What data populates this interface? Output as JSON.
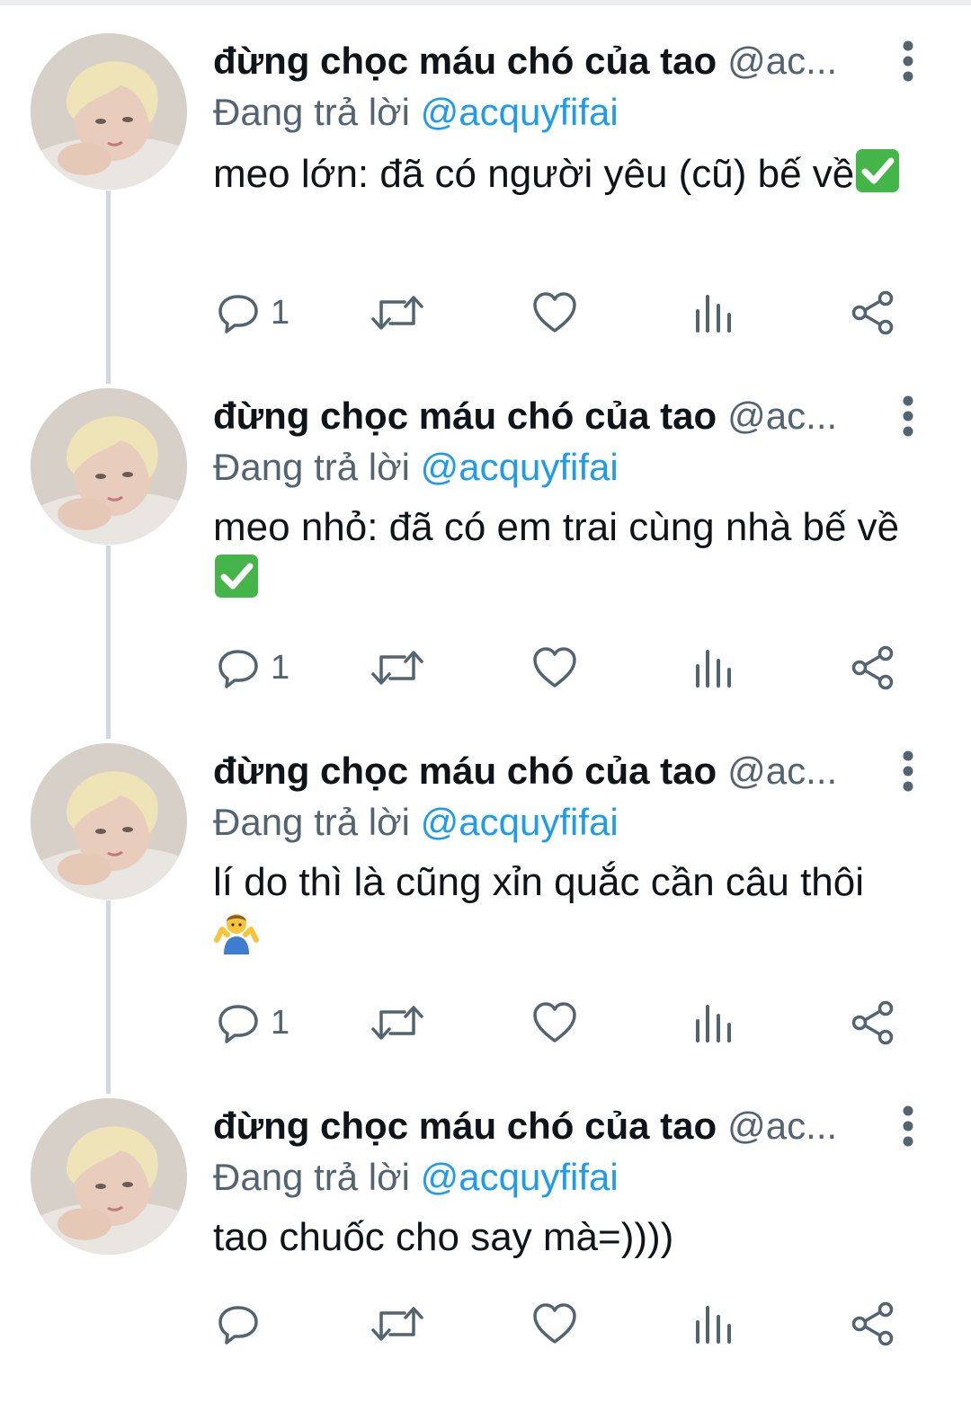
{
  "tweets": [
    {
      "display_name": "đừng chọc máu chó của tao",
      "handle": "@ac...",
      "reply_prefix": "Đang trả lời",
      "reply_mention": "@acquyfifai",
      "text": "meo lớn: đã có người yêu (cũ) bế về",
      "emoji": "check-mark-emoji",
      "reply_count": "1"
    },
    {
      "display_name": "đừng chọc máu chó của tao",
      "handle": "@ac...",
      "reply_prefix": "Đang trả lời",
      "reply_mention": "@acquyfifai",
      "text": "meo nhỏ: đã có em trai cùng nhà bế về",
      "emoji": "check-mark-emoji",
      "reply_count": "1"
    },
    {
      "display_name": "đừng chọc máu chó của tao",
      "handle": "@ac...",
      "reply_prefix": "Đang trả lời",
      "reply_mention": "@acquyfifai",
      "text": "lí do thì là cũng xỉn quắc cần câu thôi",
      "emoji": "shrug-emoji",
      "reply_count": "1"
    },
    {
      "display_name": "đừng chọc máu chó của tao",
      "handle": "@ac...",
      "reply_prefix": "Đang trả lời",
      "reply_mention": "@acquyfifai",
      "text": "tao chuốc cho say mà=))))",
      "emoji": "",
      "reply_count": ""
    }
  ],
  "icons": {
    "more": "more-vertical-icon",
    "reply": "reply-icon",
    "retweet": "retweet-icon",
    "like": "like-icon",
    "views": "views-icon",
    "share": "share-icon"
  },
  "colors": {
    "text": "#0f1419",
    "secondary": "#536471",
    "mention": "#1d9bf0",
    "thread_line": "#cfd9de",
    "check_green": "#44b549"
  }
}
